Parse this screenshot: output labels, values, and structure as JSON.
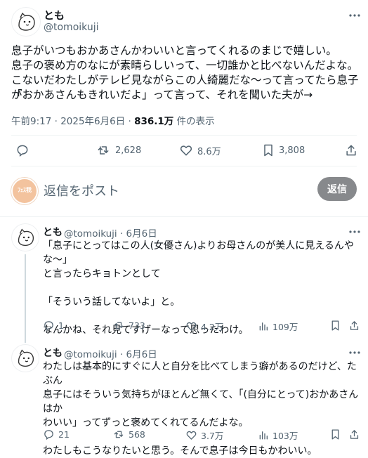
{
  "main_post": {
    "name": "とも",
    "handle": "@tomoikuji",
    "text_lines": [
      "息子がいつもおかあさんかわいいと言ってくれるのまじで嬉しい。",
      "息子の褒め方のなにが素晴らしいって、一切誰かと比べないんだよな。",
      "こないだわたしがテレビ見ながらこの人綺麗だな〜って言ってたら息子が",
      "「おかあさんもきれいだよ」って言って、それを聞いた夫が→"
    ],
    "time": "午前9:17 · 2025年6月6日 · ",
    "views": "836.1万",
    "views_suffix": " 件の表示",
    "replies": "",
    "reposts": "2,628",
    "likes": "8.6万",
    "bookmarks": "3,808"
  },
  "reply_composer": {
    "placeholder": "返信をポスト",
    "button": "返信",
    "avatar_text": "ﾌｪｽ我"
  },
  "replies": [
    {
      "name": "とも",
      "handle": "@tomoikuji · 6月6日",
      "text": "「息子にとってはこの人(女優さん)よりお母さんのが美人に見えるんやな〜」\nと言ったらキョトンとして\n\n「そういう話してないよ」と。\n\nなんかね、それ見てすげーなって思ったわけ。",
      "replies": "1",
      "reposts": "733",
      "likes": "4.2万",
      "views": "109万"
    },
    {
      "name": "とも",
      "handle": "@tomoikuji · 6月6日",
      "text": "わたしは基本的にすぐに人と自分を比べてしまう癖があるのだけど、たぶん\n息子にはそういう気持ちがほとんど無くて、「(自分にとって)おかあさんはか\nわいい」ってずっと褒めてくれてるんだよな。\n\nわたしもこうなりたいと思う。そんで息子は今日もかわいい。",
      "replies": "21",
      "reposts": "568",
      "likes": "3.7万",
      "views": "103万"
    }
  ],
  "colors": {
    "text": "#0f1419",
    "secondary": "#536471",
    "divider": "#eff3f4",
    "button": "#87898c"
  }
}
